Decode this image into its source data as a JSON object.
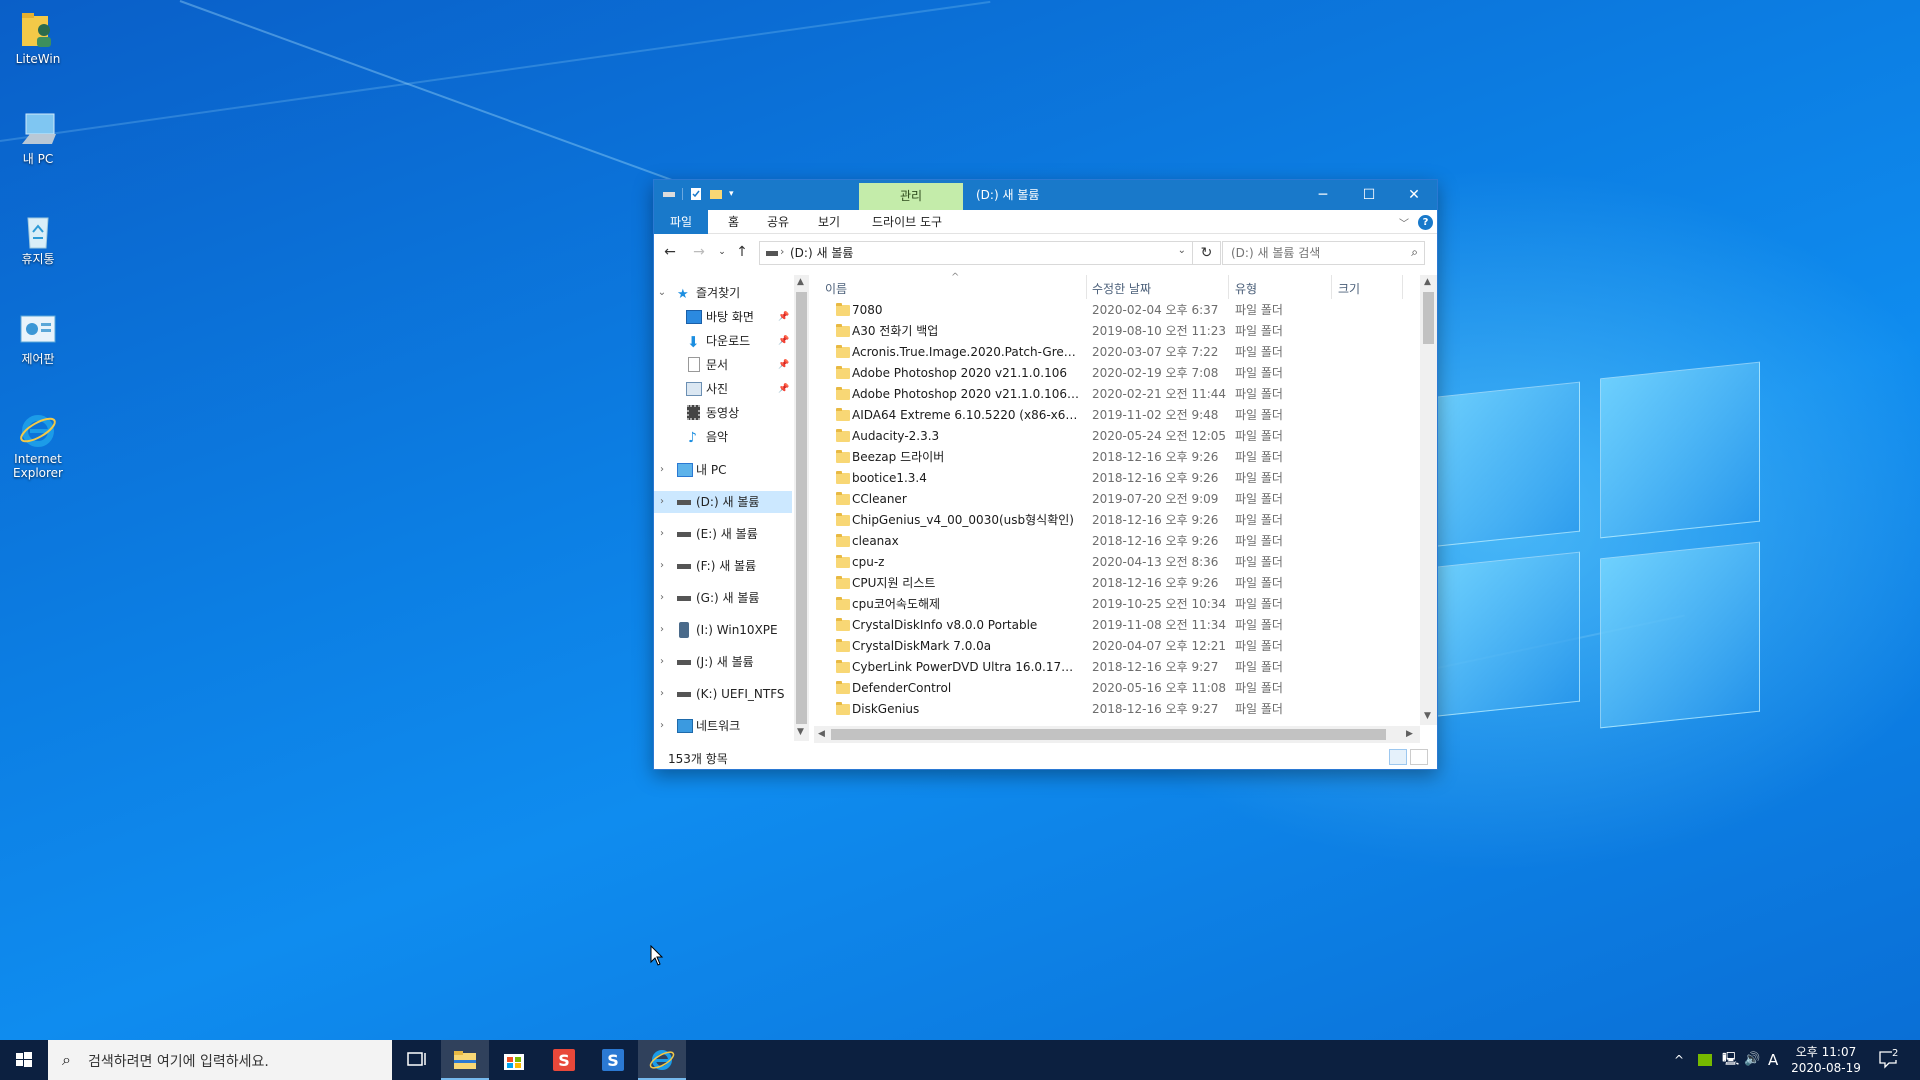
{
  "desktop": {
    "icons": [
      {
        "label": "LiteWin",
        "icon": "user-folder-icon"
      },
      {
        "label": "내 PC",
        "icon": "computer-icon"
      },
      {
        "label": "휴지통",
        "icon": "recycle-bin-icon"
      },
      {
        "label": "제어판",
        "icon": "control-panel-icon"
      },
      {
        "label": "Internet Explorer",
        "icon": "internet-explorer-icon"
      }
    ]
  },
  "window": {
    "title": "(D:) 새 볼륨",
    "context_tab": "관리",
    "ribbon_tabs": [
      "파일",
      "홈",
      "공유",
      "보기",
      "드라이브 도구"
    ],
    "address": "(D:) 새 볼륨",
    "search_placeholder": "(D:) 새 볼륨 검색",
    "nav": {
      "quick_access": "즐겨찾기",
      "pinned": [
        "바탕 화면",
        "다운로드",
        "문서",
        "사진"
      ],
      "unpinned": [
        "동영상",
        "음악"
      ],
      "this_pc": "내 PC",
      "drives": [
        "(D:) 새 볼륨",
        "(E:) 새 볼륨",
        "(F:) 새 볼륨",
        "(G:) 새 볼륨",
        "(I:) Win10XPE",
        "(J:) 새 볼륨",
        "(K:) UEFI_NTFS"
      ],
      "network": "네트워크"
    },
    "columns": {
      "name": "이름",
      "date": "수정한 날짜",
      "type": "유형",
      "size": "크기"
    },
    "files": [
      {
        "name": "7080",
        "date": "2020-02-04 오후 6:37",
        "type": "파일 폴더"
      },
      {
        "name": "A30 전화기 백업",
        "date": "2019-08-10 오전 11:23",
        "type": "파일 폴더"
      },
      {
        "name": "Acronis.True.Image.2020.Patch-GreenGn...",
        "date": "2020-03-07 오후 7:22",
        "type": "파일 폴더"
      },
      {
        "name": "Adobe Photoshop 2020 v21.1.0.106",
        "date": "2020-02-19 오후 7:08",
        "type": "파일 폴더"
      },
      {
        "name": "Adobe Photoshop 2020 v21.1.0.106 Po...",
        "date": "2020-02-21 오전 11:44",
        "type": "파일 폴더"
      },
      {
        "name": "AIDA64 Extreme 6.10.5220 (x86-x64) B...",
        "date": "2019-11-02 오전 9:48",
        "type": "파일 폴더"
      },
      {
        "name": "Audacity-2.3.3",
        "date": "2020-05-24 오전 12:05",
        "type": "파일 폴더"
      },
      {
        "name": "Beezap 드라이버",
        "date": "2018-12-16 오후 9:26",
        "type": "파일 폴더"
      },
      {
        "name": "bootice1.3.4",
        "date": "2018-12-16 오후 9:26",
        "type": "파일 폴더"
      },
      {
        "name": "CCleaner",
        "date": "2019-07-20 오전 9:09",
        "type": "파일 폴더"
      },
      {
        "name": "ChipGenius_v4_00_0030(usb형식확인)",
        "date": "2018-12-16 오후 9:26",
        "type": "파일 폴더"
      },
      {
        "name": "cleanax",
        "date": "2018-12-16 오후 9:26",
        "type": "파일 폴더"
      },
      {
        "name": "cpu-z",
        "date": "2020-04-13 오전 8:36",
        "type": "파일 폴더"
      },
      {
        "name": "CPU지원 리스트",
        "date": "2018-12-16 오후 9:26",
        "type": "파일 폴더"
      },
      {
        "name": "cpu코어속도해제",
        "date": "2019-10-25 오전 10:34",
        "type": "파일 폴더"
      },
      {
        "name": "CrystalDiskInfo v8.0.0 Portable",
        "date": "2019-11-08 오전 11:34",
        "type": "파일 폴더"
      },
      {
        "name": "CrystalDiskMark 7.0.0a",
        "date": "2020-04-07 오후 12:21",
        "type": "파일 폴더"
      },
      {
        "name": "CyberLink PowerDVD Ultra 16.0.1713.6...",
        "date": "2018-12-16 오후 9:27",
        "type": "파일 폴더"
      },
      {
        "name": "DefenderControl",
        "date": "2020-05-16 오후 11:08",
        "type": "파일 폴더"
      },
      {
        "name": "DiskGenius",
        "date": "2018-12-16 오후 9:27",
        "type": "파일 폴더"
      }
    ],
    "status": "153개 항목"
  },
  "taskbar": {
    "search_placeholder": "검색하려면 여기에 입력하세요.",
    "ime": "A",
    "time": "오후 11:07",
    "date": "2020-08-19",
    "notifications": "2"
  },
  "colors": {
    "accent": "#1979ca",
    "context_tab": "#c4ecaa",
    "selection": "#cce8ff",
    "taskbar": "#0c2040"
  }
}
